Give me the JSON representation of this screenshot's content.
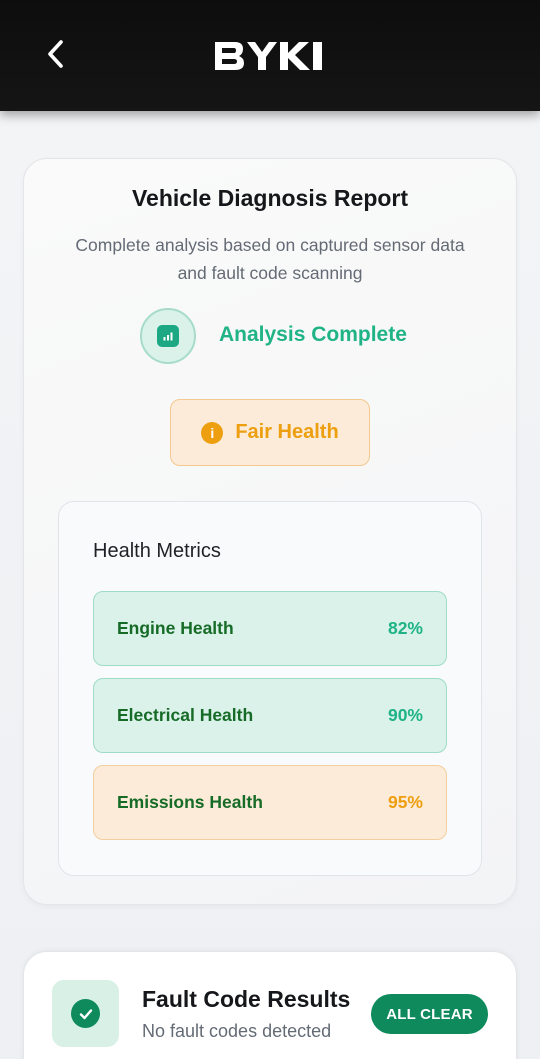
{
  "header": {
    "back_icon": "chevron-left-icon",
    "logo_text": "BYKI"
  },
  "report": {
    "title": "Vehicle Diagnosis Report",
    "subtitle": "Complete analysis based on captured sensor data and fault code scanning",
    "analysis_icon": "bar-chart-icon",
    "analysis_status": "Analysis Complete",
    "health_icon": "info-icon",
    "health_status": "Fair Health"
  },
  "metrics": {
    "title": "Health Metrics",
    "items": [
      {
        "label": "Engine Health",
        "value": "82%",
        "tone": "green"
      },
      {
        "label": "Electrical Health",
        "value": "90%",
        "tone": "green"
      },
      {
        "label": "Emissions Health",
        "value": "95%",
        "tone": "orange"
      }
    ]
  },
  "fault": {
    "icon": "check-circle-icon",
    "title": "Fault Code Results",
    "subtitle": "No fault codes detected",
    "badge": "ALL CLEAR"
  },
  "colors": {
    "accent_green": "#1fb386",
    "dark_green": "#0e8a5c",
    "warning_orange": "#ee9f10",
    "metric_label_green": "#166b27"
  }
}
